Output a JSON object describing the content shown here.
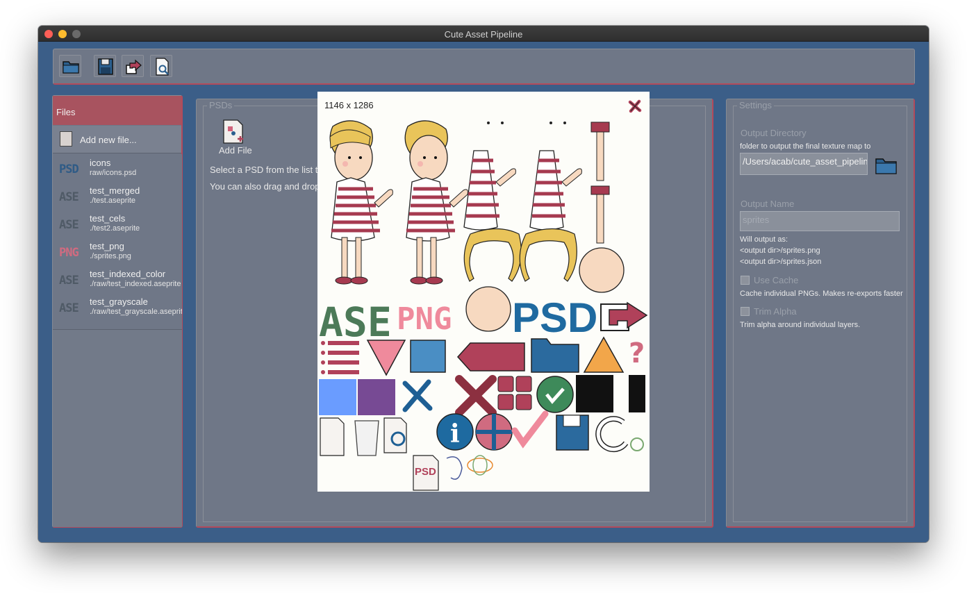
{
  "window": {
    "title": "Cute Asset Pipeline"
  },
  "toolbar": {
    "buttons": [
      "open-folder",
      "save",
      "export",
      "preview"
    ]
  },
  "files": {
    "header": "Files",
    "add_new_label": "Add new file...",
    "items": [
      {
        "badge": "PSD",
        "badge_color": "#2f5b86",
        "name": "icons",
        "path": "raw/icons.psd"
      },
      {
        "badge": "ASE",
        "badge_color": "#4f5a66",
        "name": "test_merged",
        "path": "./test.aseprite"
      },
      {
        "badge": "ASE",
        "badge_color": "#4f5a66",
        "name": "test_cels",
        "path": "./test2.aseprite"
      },
      {
        "badge": "PNG",
        "badge_color": "#d06b80",
        "name": "test_png",
        "path": "./sprites.png"
      },
      {
        "badge": "ASE",
        "badge_color": "#4f5a66",
        "name": "test_indexed_color",
        "path": "./raw/test_indexed.aseprite"
      },
      {
        "badge": "ASE",
        "badge_color": "#4f5a66",
        "name": "test_grayscale",
        "path": "./raw/test_grayscale.aseprite"
      }
    ]
  },
  "psds": {
    "legend": "PSDs",
    "add_file_label": "Add File",
    "help_line1": "Select a PSD from the list to",
    "help_line2": "You can also drag and drop"
  },
  "settings": {
    "legend": "Settings",
    "output_directory_label": "Output Directory",
    "output_directory_help": "folder to output the final texture map to",
    "output_directory_value": "/Users/acab/cute_asset_pipeline",
    "output_name_label": "Output Name",
    "output_name_placeholder": "sprites",
    "will_output_label": "Will output as:",
    "will_output_png": "<output dir>/sprites.png",
    "will_output_json": "<output dir>/sprites.json",
    "use_cache_label": "Use Cache",
    "use_cache_help": "Cache individual PNGs. Makes re-exports faster",
    "trim_alpha_label": "Trim Alpha",
    "trim_alpha_help": "Trim alpha around individual layers."
  },
  "preview": {
    "size_text": "1146 x 1286",
    "sprite_text_ase": "ASE",
    "sprite_text_png": "PNG",
    "sprite_text_psd": "PSD",
    "sprite_text_psd_small": "PSD"
  }
}
